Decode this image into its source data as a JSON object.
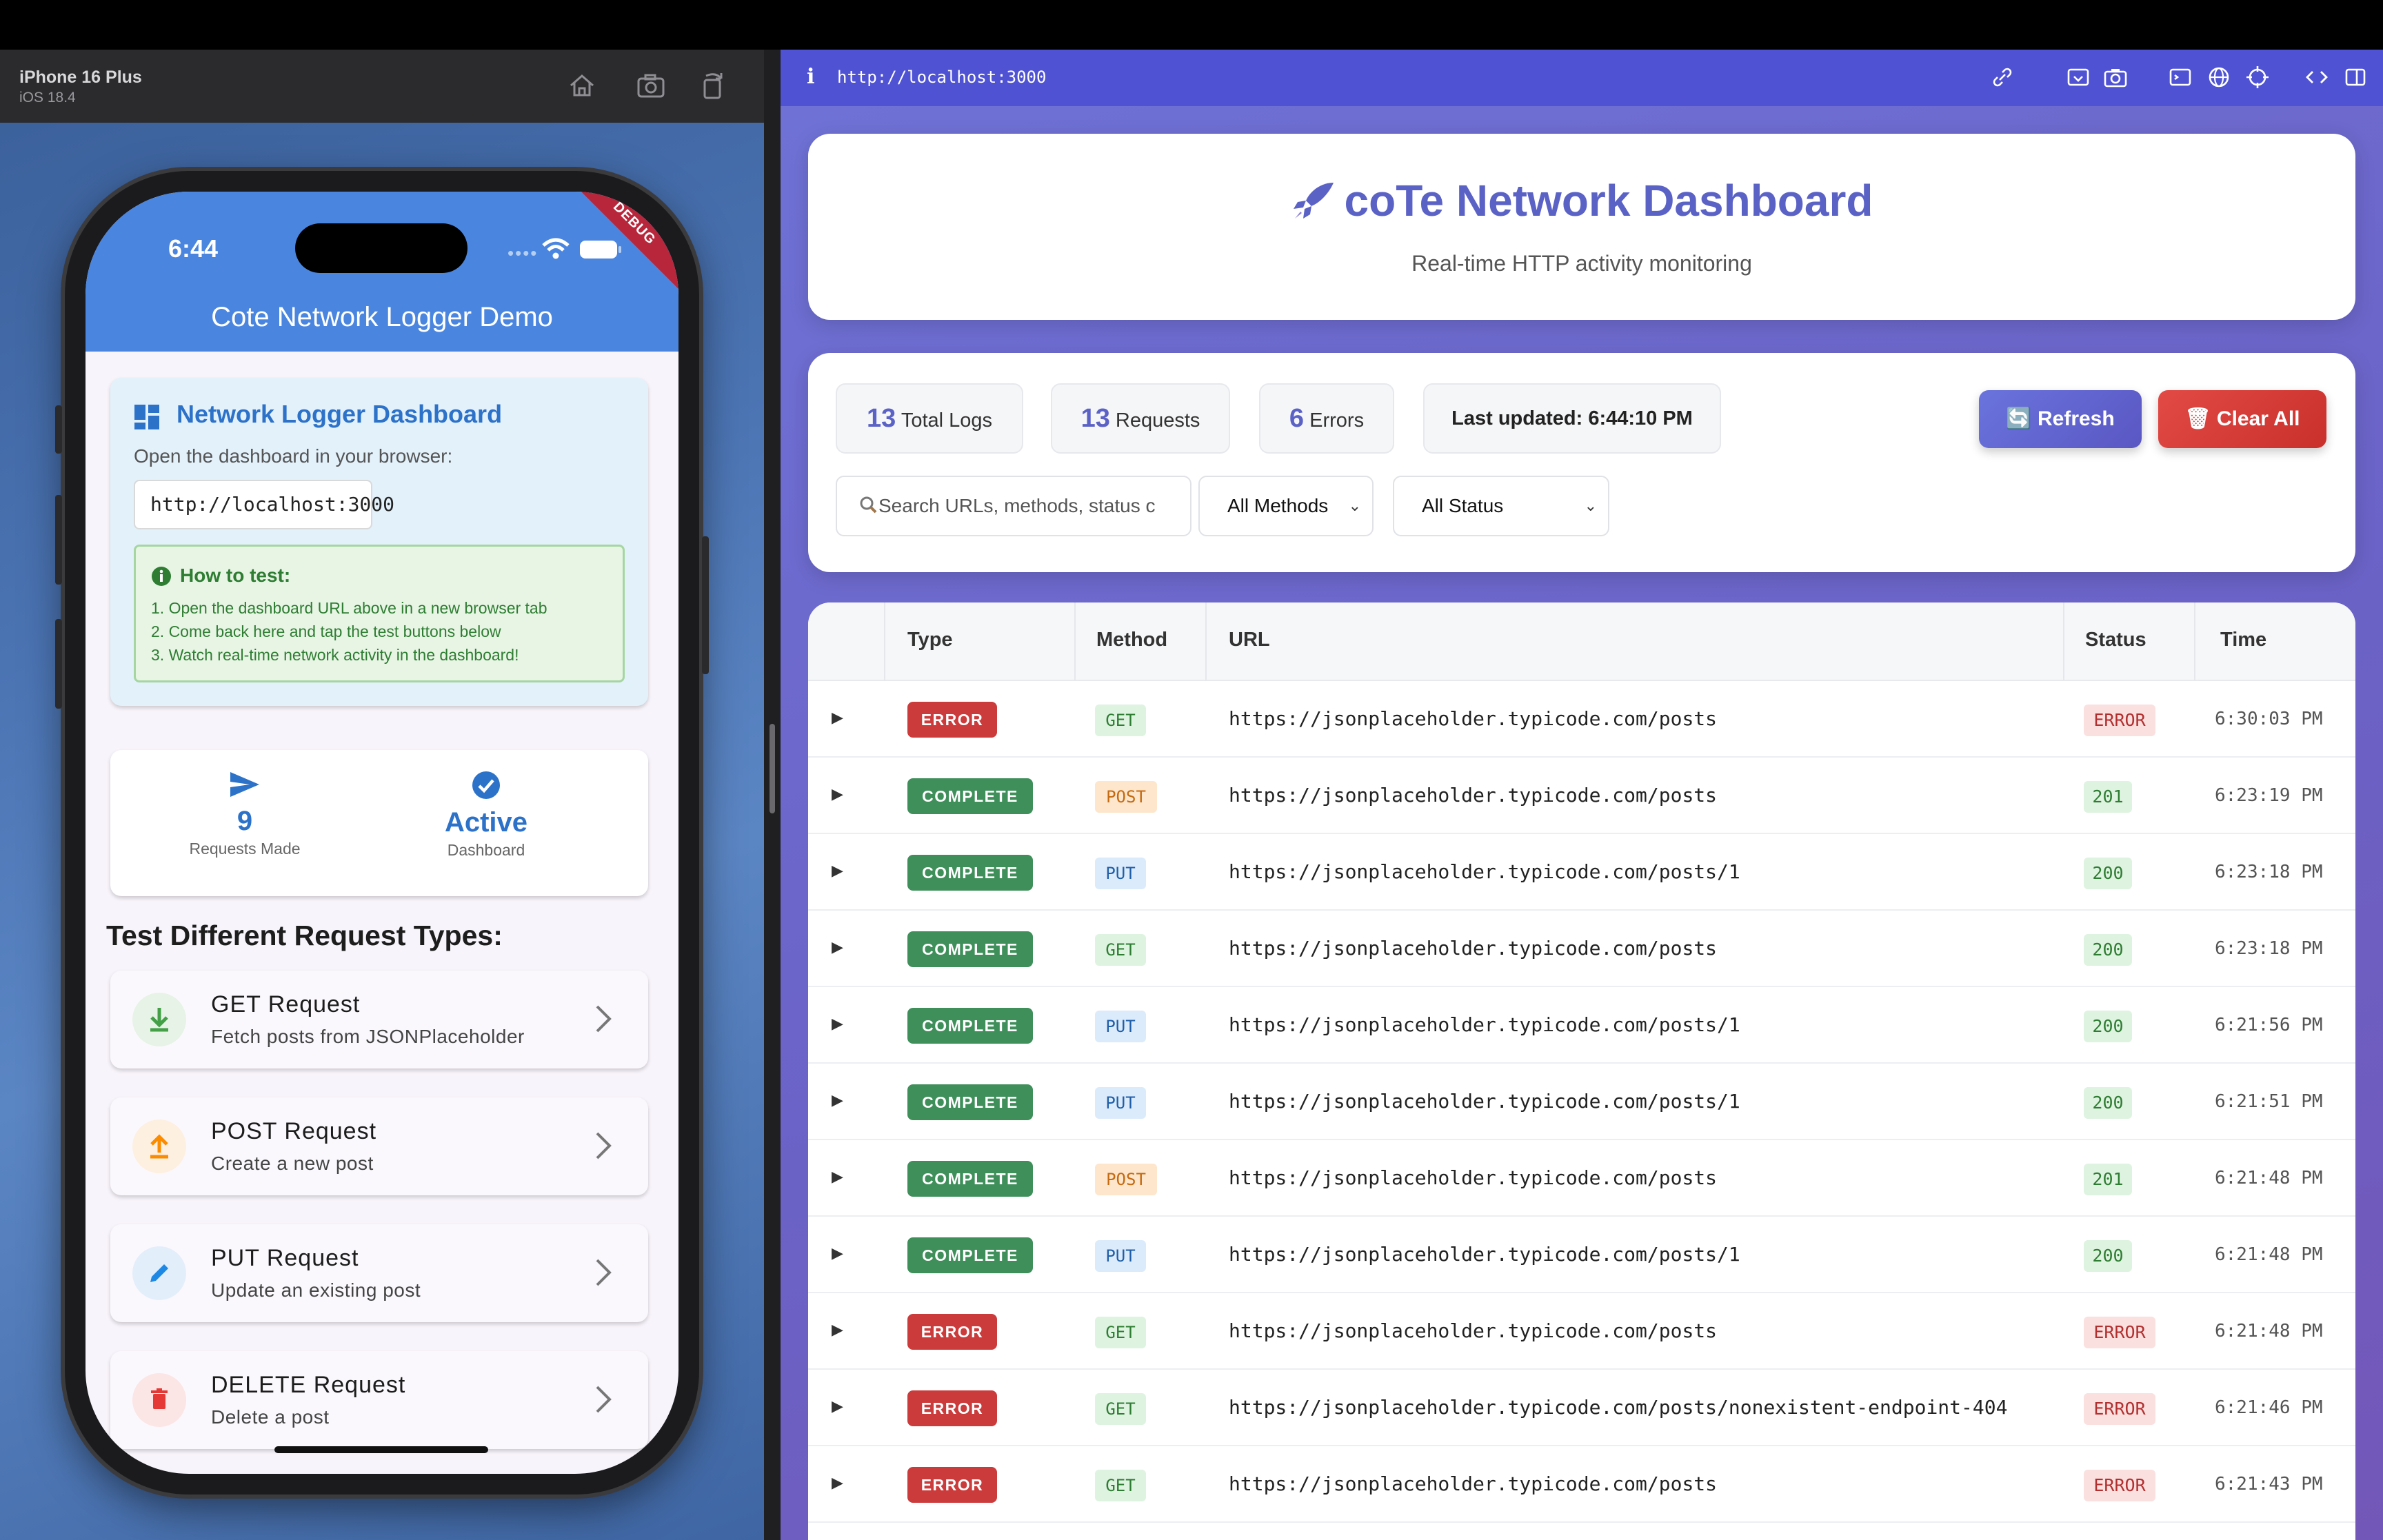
{
  "simulator": {
    "device": "iPhone 16 Plus",
    "os": "iOS 18.4",
    "status_time": "6:44",
    "debug_banner": "DEBUG"
  },
  "app": {
    "title": "Cote Network Logger Demo",
    "dashboard_card": {
      "title": "Network Logger Dashboard",
      "description": "Open the dashboard in your browser:",
      "url": "http://localhost:3000",
      "howto_title": "How to test:",
      "steps": [
        "1. Open the dashboard URL above in a new browser tab",
        "2. Come back here and tap the test buttons below",
        "3. Watch real-time network activity in the dashboard!"
      ]
    },
    "stats": {
      "requests_value": "9",
      "requests_label": "Requests Made",
      "dashboard_value": "Active",
      "dashboard_label": "Dashboard"
    },
    "section_title": "Test Different Request Types:",
    "requests": [
      {
        "title": "GET Request",
        "subtitle": "Fetch posts from JSONPlaceholder",
        "icon": "download-icon",
        "color": "#43a047"
      },
      {
        "title": "POST Request",
        "subtitle": "Create a new post",
        "icon": "upload-icon",
        "color": "#fb8c00"
      },
      {
        "title": "PUT Request",
        "subtitle": "Update an existing post",
        "icon": "edit-icon",
        "color": "#1e88e5"
      },
      {
        "title": "DELETE Request",
        "subtitle": "Delete a post",
        "icon": "trash-icon",
        "color": "#e53935"
      }
    ]
  },
  "browser": {
    "url": "http://localhost:3000",
    "info_icon": "i"
  },
  "dashboard": {
    "title": "coTe Network Dashboard",
    "subtitle": "Real-time HTTP activity monitoring",
    "stats": {
      "total_logs_value": "13",
      "total_logs_label": "Total Logs",
      "requests_value": "13",
      "requests_label": "Requests",
      "errors_value": "6",
      "errors_label": "Errors",
      "last_updated": "Last updated: 6:44:10 PM"
    },
    "buttons": {
      "refresh": "🔄 Refresh",
      "clear": "🗑 Clear All"
    },
    "search_placeholder": "Search URLs, methods, status c",
    "method_filter": "All Methods",
    "status_filter": "All Status",
    "columns": [
      "Type",
      "Method",
      "URL",
      "Status",
      "Time"
    ],
    "rows": [
      {
        "type": "ERROR",
        "method": "GET",
        "url": "https://jsonplaceholder.typicode.com/posts",
        "status": "ERROR",
        "time": "6:30:03 PM"
      },
      {
        "type": "COMPLETE",
        "method": "POST",
        "url": "https://jsonplaceholder.typicode.com/posts",
        "status": "201",
        "time": "6:23:19 PM"
      },
      {
        "type": "COMPLETE",
        "method": "PUT",
        "url": "https://jsonplaceholder.typicode.com/posts/1",
        "status": "200",
        "time": "6:23:18 PM"
      },
      {
        "type": "COMPLETE",
        "method": "GET",
        "url": "https://jsonplaceholder.typicode.com/posts",
        "status": "200",
        "time": "6:23:18 PM"
      },
      {
        "type": "COMPLETE",
        "method": "PUT",
        "url": "https://jsonplaceholder.typicode.com/posts/1",
        "status": "200",
        "time": "6:21:56 PM"
      },
      {
        "type": "COMPLETE",
        "method": "PUT",
        "url": "https://jsonplaceholder.typicode.com/posts/1",
        "status": "200",
        "time": "6:21:51 PM"
      },
      {
        "type": "COMPLETE",
        "method": "POST",
        "url": "https://jsonplaceholder.typicode.com/posts",
        "status": "201",
        "time": "6:21:48 PM"
      },
      {
        "type": "COMPLETE",
        "method": "PUT",
        "url": "https://jsonplaceholder.typicode.com/posts/1",
        "status": "200",
        "time": "6:21:48 PM"
      },
      {
        "type": "ERROR",
        "method": "GET",
        "url": "https://jsonplaceholder.typicode.com/posts",
        "status": "ERROR",
        "time": "6:21:48 PM"
      },
      {
        "type": "ERROR",
        "method": "GET",
        "url": "https://jsonplaceholder.typicode.com/posts/nonexistent-endpoint-404",
        "status": "ERROR",
        "time": "6:21:46 PM"
      },
      {
        "type": "ERROR",
        "method": "GET",
        "url": "https://jsonplaceholder.typicode.com/posts",
        "status": "ERROR",
        "time": "6:21:43 PM"
      }
    ]
  }
}
